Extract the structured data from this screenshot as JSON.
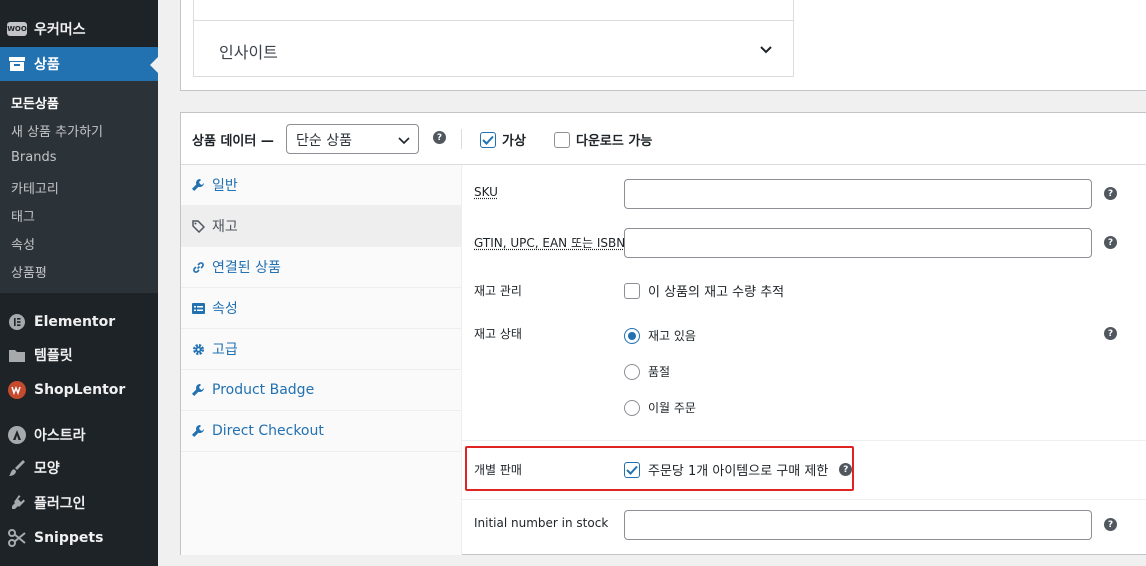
{
  "sidebar": {
    "woocommerce": {
      "label": "우커머스",
      "icon": "woo-badge-icon",
      "badge_text": "WOO"
    },
    "products": {
      "label": "상품",
      "icon": "archive-icon"
    },
    "submenu": [
      {
        "label": "모든상품"
      },
      {
        "label": "새 상품 추가하기"
      },
      {
        "label": "Brands"
      },
      {
        "label": "카테고리"
      },
      {
        "label": "태그"
      },
      {
        "label": "속성"
      },
      {
        "label": "상품평"
      }
    ],
    "elementor": {
      "label": "Elementor"
    },
    "templates": {
      "label": "템플릿"
    },
    "shoplentor": {
      "label": "ShopLentor"
    },
    "astra": {
      "label": "아스트라"
    },
    "appearance": {
      "label": "모양"
    },
    "plugins": {
      "label": "플러그인"
    },
    "snippets": {
      "label": "Snippets"
    }
  },
  "insight": {
    "label": "인사이트"
  },
  "product_data": {
    "title": "상품 데이터 —",
    "type_value": "단순 상품",
    "virtual_label": "가상",
    "virtual_checked": true,
    "downloadable_label": "다운로드 가능",
    "downloadable_checked": false
  },
  "tabs": [
    {
      "label": "일반",
      "icon": "wrench-icon"
    },
    {
      "label": "재고",
      "icon": "tag-icon",
      "active": true
    },
    {
      "label": "연결된 상품",
      "icon": "link-icon"
    },
    {
      "label": "속성",
      "icon": "list-icon"
    },
    {
      "label": "고급",
      "icon": "gear-icon"
    },
    {
      "label": "Product Badge",
      "icon": "wrench-icon"
    },
    {
      "label": "Direct Checkout",
      "icon": "wrench-icon"
    }
  ],
  "inventory": {
    "sku_label": "SKU",
    "sku_value": "",
    "gtin_label": "GTIN, UPC, EAN 또는 ISBN",
    "gtin_value": "",
    "manage_stock_label": "재고 관리",
    "manage_stock_text": "이 상품의 재고 수량 추적",
    "manage_stock_checked": false,
    "stock_status_label": "재고 상태",
    "stock_options": [
      {
        "label": "재고 있음",
        "selected": true
      },
      {
        "label": "품절",
        "selected": false
      },
      {
        "label": "이월 주문",
        "selected": false
      }
    ],
    "sold_individually_label": "개별 판매",
    "sold_individually_text": "주문당 1개 아이템으로 구매 제한",
    "sold_individually_checked": true,
    "initial_stock_label": "Initial number in stock",
    "initial_stock_value": ""
  },
  "colors": {
    "accent": "#2271b1",
    "sidebar_bg": "#1d2327",
    "highlight": "#e02424"
  }
}
